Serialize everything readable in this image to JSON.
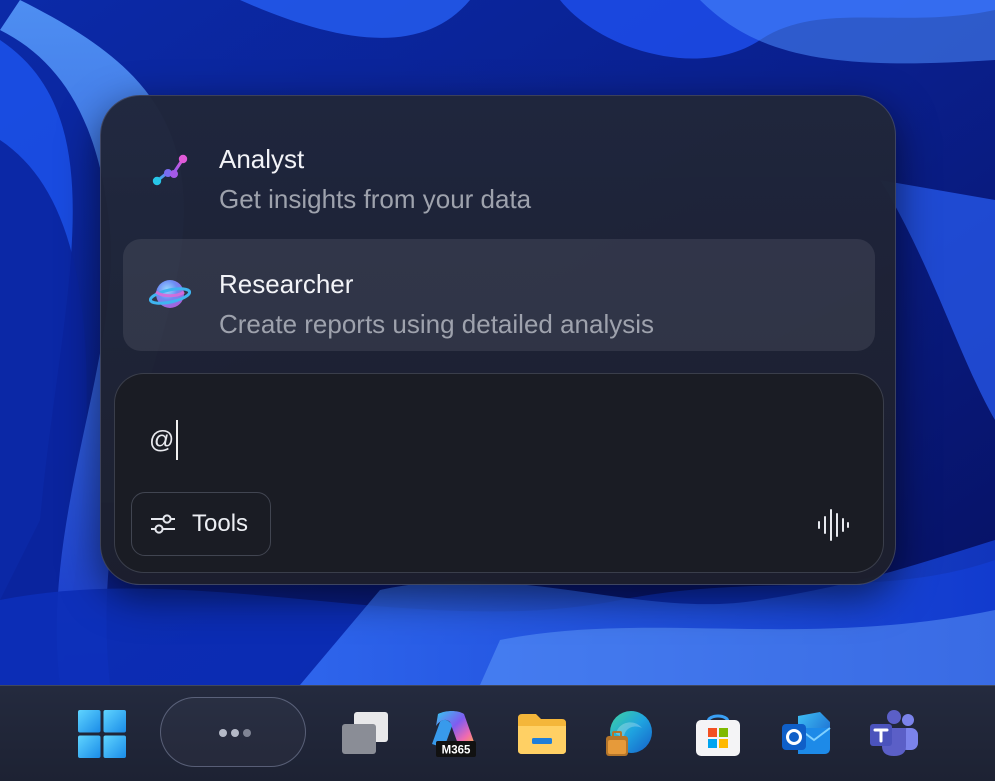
{
  "agents": [
    {
      "title": "Analyst",
      "description": "Get insights from your data",
      "icon": "analyst-icon",
      "selected": false
    },
    {
      "title": "Researcher",
      "description": "Create reports using detailed analysis",
      "icon": "researcher-icon",
      "selected": true
    }
  ],
  "composer": {
    "input_value": "@",
    "tools_label": "Tools",
    "voice_icon": "voice-waveform-icon"
  },
  "taskbar": {
    "items": [
      "start-icon",
      "task-pill",
      "task-view-icon",
      "microsoft-365-copilot-icon",
      "file-explorer-icon",
      "edge-icon",
      "microsoft-store-icon",
      "outlook-icon",
      "teams-icon"
    ],
    "m365_badge": "M365"
  },
  "colors": {
    "popup_bg": "#20263a",
    "composer_bg": "#1a1c24",
    "text_primary": "#f2f3f7",
    "text_secondary": "#9ea2ad",
    "taskbar_bg": "#242a3e"
  }
}
